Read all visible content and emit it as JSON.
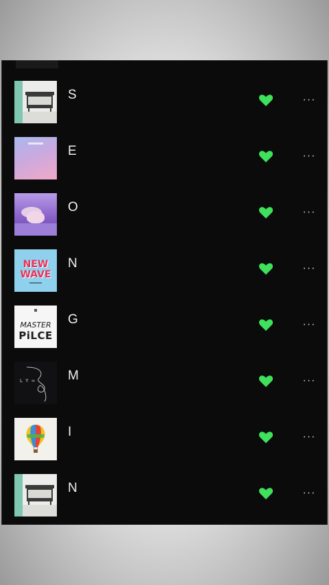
{
  "tracks": [
    {
      "title": "S",
      "cover": "bench-album-cover",
      "liked": true,
      "more_icon": "more-icon"
    },
    {
      "title": "E",
      "cover": "pastel-album-cover",
      "liked": true,
      "more_icon": "more-icon"
    },
    {
      "title": "O",
      "cover": "sleeping-album-cover",
      "liked": true,
      "more_icon": "more-icon"
    },
    {
      "title": "N",
      "cover": "new-wave-album-cover",
      "cover_text": [
        "NEW",
        "WAVE"
      ],
      "liked": true,
      "more_icon": "more-icon"
    },
    {
      "title": "G",
      "cover": "masterpiece-album-cover",
      "cover_text": [
        "MASTER",
        "PiLCE"
      ],
      "liked": true,
      "more_icon": "more-icon"
    },
    {
      "title": "M",
      "cover": "love-yourself-album-cover",
      "cover_text": [
        "L Y ∞"
      ],
      "liked": true,
      "more_icon": "more-icon"
    },
    {
      "title": "I",
      "cover": "balloon-album-cover",
      "liked": true,
      "more_icon": "more-icon"
    },
    {
      "title": "N",
      "cover": "bench-album-cover",
      "liked": true,
      "more_icon": "more-icon"
    }
  ],
  "more_label": "···",
  "colors": {
    "heart": "#3ee05c",
    "background": "#0b0b0c",
    "text": "#f2f2f2"
  }
}
